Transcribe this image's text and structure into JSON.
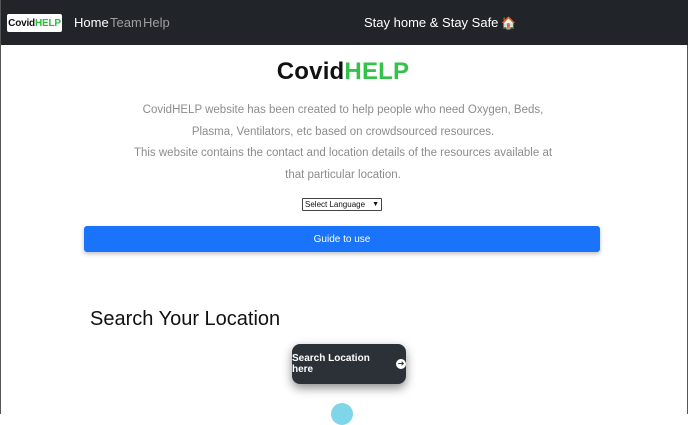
{
  "navbar": {
    "brand": {
      "covid": "Covid",
      "help": "HELP"
    },
    "links": [
      "Home",
      "Team",
      "Help"
    ],
    "tagline": "Stay home & Stay Safe",
    "tagline_icon": "house-icon"
  },
  "hero": {
    "logo": {
      "covid": "Covid",
      "help": "HELP"
    },
    "intro_line1": "CovidHELP website has been created to help people who need Oxygen, Beds,",
    "intro_line2": "Plasma, Ventilators, etc based on crowdsourced resources.",
    "intro_line3": "This website contains the contact and location details of the resources available at",
    "intro_line4": "that particular location.",
    "language_select": "Select Language",
    "guide_button": "Guide to use"
  },
  "search": {
    "heading": "Search Your Location",
    "button": "Search Location here"
  },
  "colors": {
    "nav_bg": "#212529",
    "accent_green": "#35c24a",
    "primary_blue": "#1a73fb",
    "dark_button": "#2c3137"
  }
}
